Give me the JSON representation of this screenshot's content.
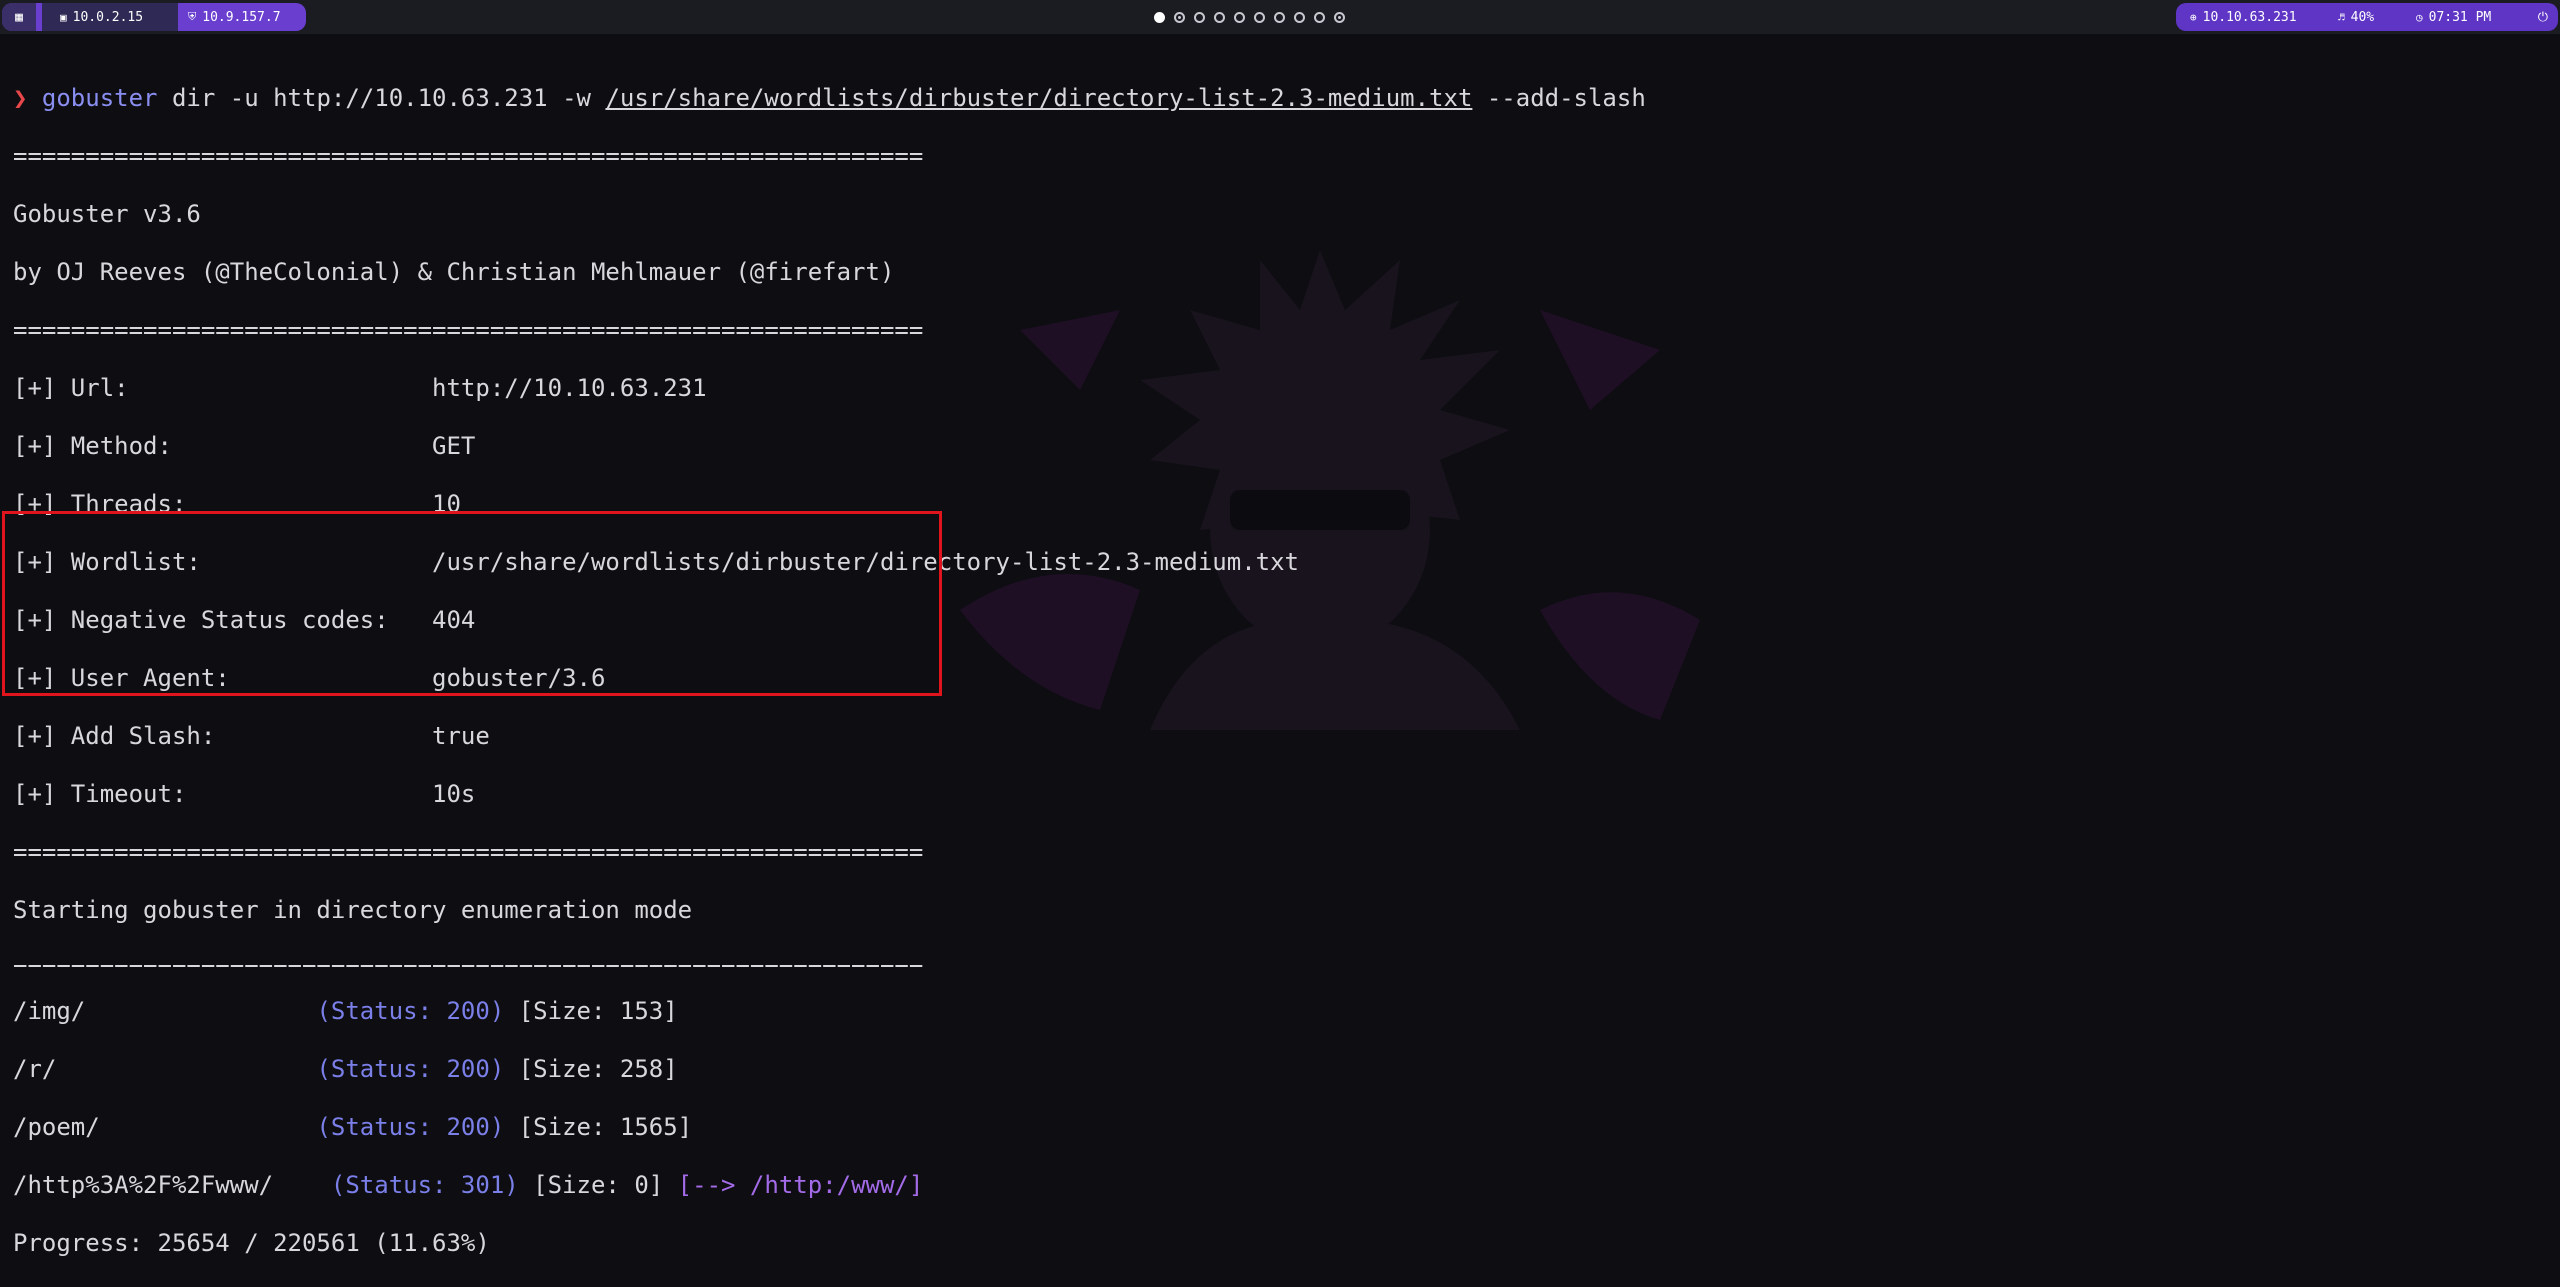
{
  "topbar": {
    "menu_icon": "grid-icon",
    "ip_local": "10.0.2.15",
    "ip_vpn": "10.9.157.7",
    "workspaces": [
      "1",
      "2",
      "3",
      "4",
      "5",
      "6",
      "7",
      "8",
      "9",
      "10"
    ],
    "target_ip": "10.10.63.231",
    "volume": "40%",
    "clock": "07:31 PM"
  },
  "terminal": {
    "prompt_symbol": "❯",
    "command_name": "gobuster",
    "command_args": " dir -u http://10.10.63.231 -w ",
    "command_wordlist": "/usr/share/wordlists/dirbuster/directory-list-2.3-medium.txt",
    "command_tail": " --add-slash",
    "separator": "===============================================================",
    "banner_version": "Gobuster v3.6",
    "banner_authors": "by OJ Reeves (@TheColonial) & Christian Mehlmauer (@firefart)",
    "config": [
      {
        "key": "[+] Url:                     ",
        "value": "http://10.10.63.231"
      },
      {
        "key": "[+] Method:                  ",
        "value": "GET"
      },
      {
        "key": "[+] Threads:                 ",
        "value": "10"
      },
      {
        "key": "[+] Wordlist:                ",
        "value": "/usr/share/wordlists/dirbuster/directory-list-2.3-medium.txt"
      },
      {
        "key": "[+] Negative Status codes:   ",
        "value": "404"
      },
      {
        "key": "[+] User Agent:              ",
        "value": "gobuster/3.6"
      },
      {
        "key": "[+] Add Slash:               ",
        "value": "true"
      },
      {
        "key": "[+] Timeout:                 ",
        "value": "10s"
      }
    ],
    "start_message": "Starting gobuster in directory enumeration mode",
    "results": [
      {
        "path": "/img/                ",
        "status": "(Status: 200)",
        "size": " [Size: 153]",
        "redirect": ""
      },
      {
        "path": "/r/                  ",
        "status": "(Status: 200)",
        "size": " [Size: 258]",
        "redirect": ""
      },
      {
        "path": "/poem/               ",
        "status": "(Status: 200)",
        "size": " [Size: 1565]",
        "redirect": ""
      },
      {
        "path": "/http%3A%2F%2Fwww/    ",
        "status": "(Status: 301)",
        "size": " [Size: 0]",
        "redirect": " [--> /http:/www/]"
      }
    ],
    "progress": "Progress: 25654 / 220561 (11.63%)"
  }
}
